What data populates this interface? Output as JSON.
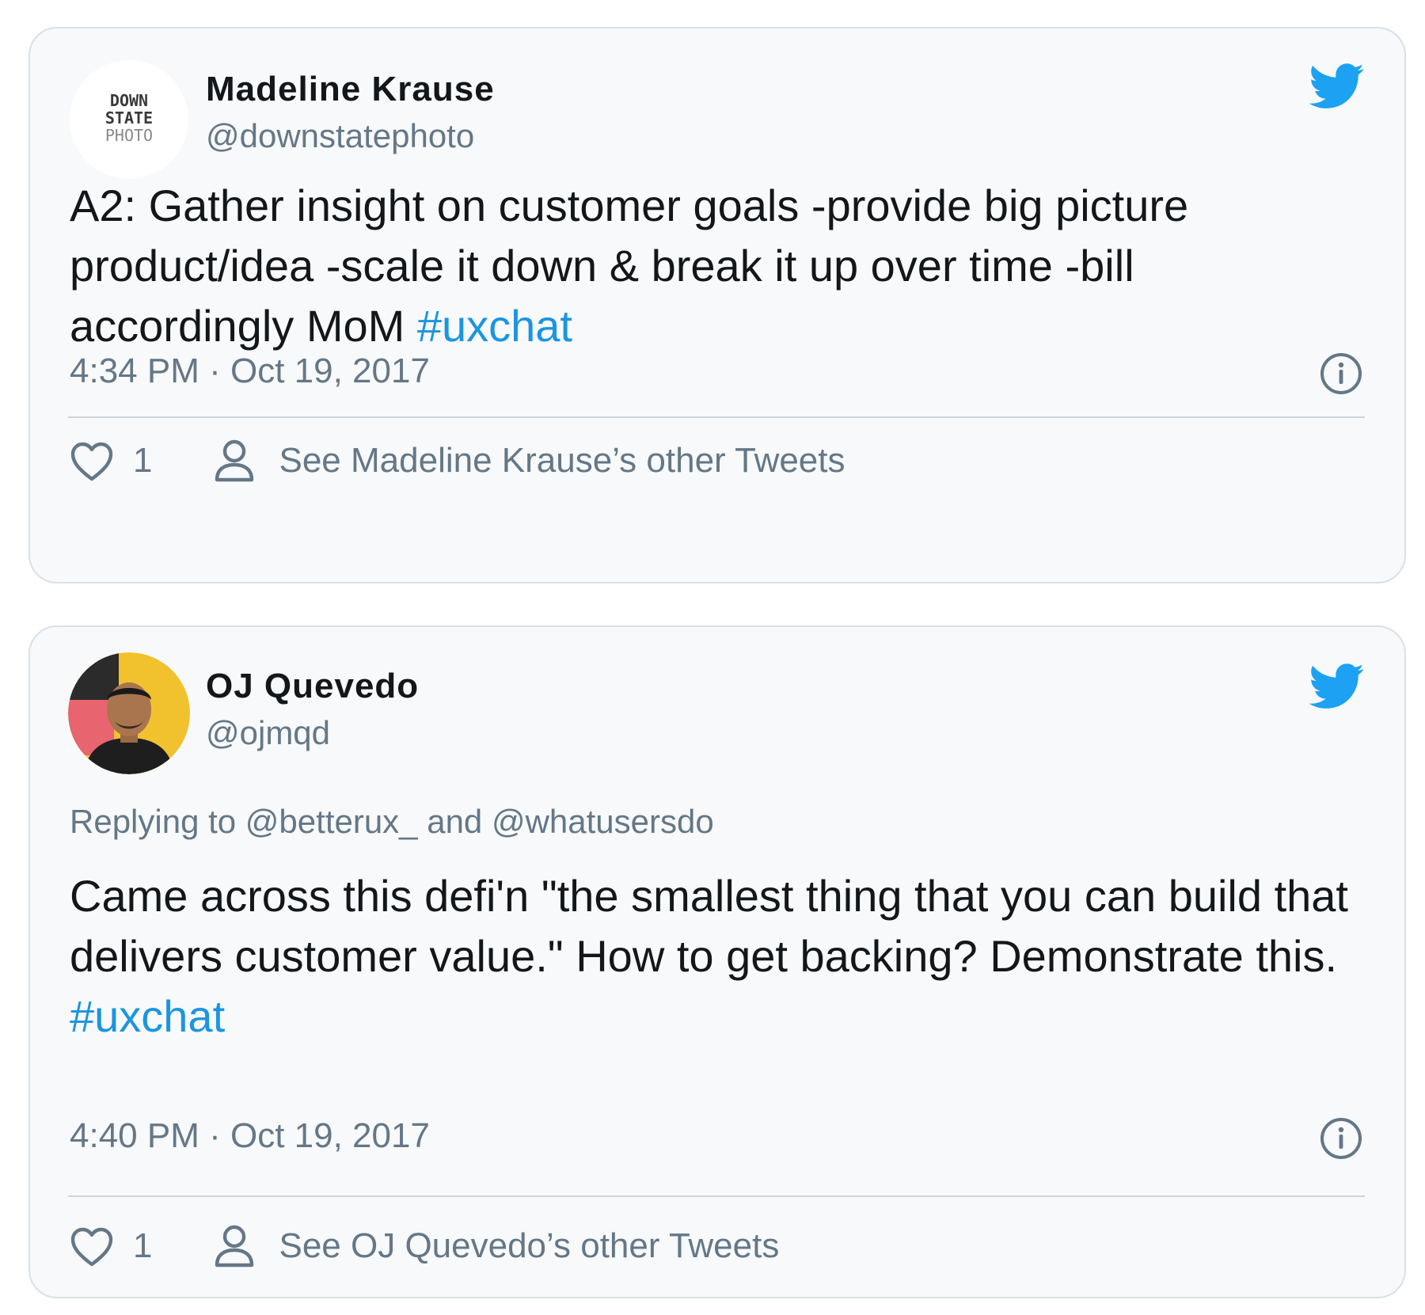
{
  "tweets": [
    {
      "name": "Madeline Krause",
      "handle": "@downstatephoto",
      "avatar_logo_text": [
        "DOWN",
        "STATE",
        "PHOTO"
      ],
      "text": "A2: Gather insight on customer goals -provide big picture product/idea -scale it down & break it up over time -bill accordingly MoM ",
      "hashtag": "#uxchat",
      "timestamp": "4:34 PM · Oct 19, 2017",
      "likes": "1",
      "other_tweets_label": "See Madeline Krause’s other Tweets"
    },
    {
      "name": "OJ Quevedo",
      "handle": "@ojmqd",
      "replying_to": "Replying to @betterux_ and @whatusersdo",
      "text": "Came across this defi'n \"the smallest thing that you can build that delivers customer value.\" How to get backing? Demonstrate this.",
      "hashtag": "#uxchat",
      "timestamp": "4:40 PM · Oct 19, 2017",
      "likes": "1",
      "other_tweets_label": "See OJ Quevedo’s other Tweets"
    }
  ],
  "icons": {
    "brand": "twitter-bird-icon",
    "info": "info-icon",
    "like": "heart-icon",
    "profile": "person-icon"
  },
  "colors": {
    "card_background": "#f7f9fa",
    "card_border": "#d9e1e8",
    "twitter_blue": "#1da1f2",
    "hashtag": "#1b95e0",
    "secondary_text": "#657786",
    "primary_text": "#14171a"
  }
}
